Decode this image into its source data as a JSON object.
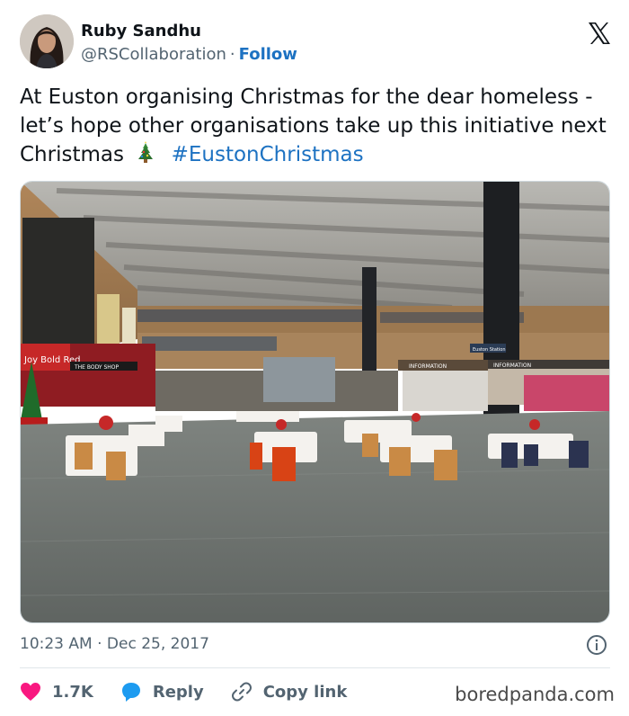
{
  "author": {
    "name": "Ruby Sandhu",
    "handle": "@RSCollaboration",
    "separator": "·",
    "follow_label": "Follow"
  },
  "tweet": {
    "text_before": "At Euston organising Christmas for the dear homeless - let’s hope other organisations take up this initiative next Christmas",
    "hashtag": "#EustonChristmas",
    "emoji_icon": "christmas-tree-icon"
  },
  "media": {
    "signs": {
      "left_banner": "Joy Bold Red",
      "left_shop": "THE BODY SHOP",
      "info_left": "INFORMATION",
      "info_right": "INFORMATION",
      "station_sign": "Euston Station"
    }
  },
  "meta": {
    "time": "10:23 AM",
    "separator": "·",
    "date": "Dec 25, 2017"
  },
  "actions": {
    "like_count": "1.7K",
    "reply_label": "Reply",
    "copy_link_label": "Copy link"
  },
  "watermark": "boredpanda.com",
  "colors": {
    "accent_blue": "#1d72c2",
    "like_red": "#f91880",
    "reply_blue": "#1d9bf0",
    "text_muted": "#536471"
  }
}
